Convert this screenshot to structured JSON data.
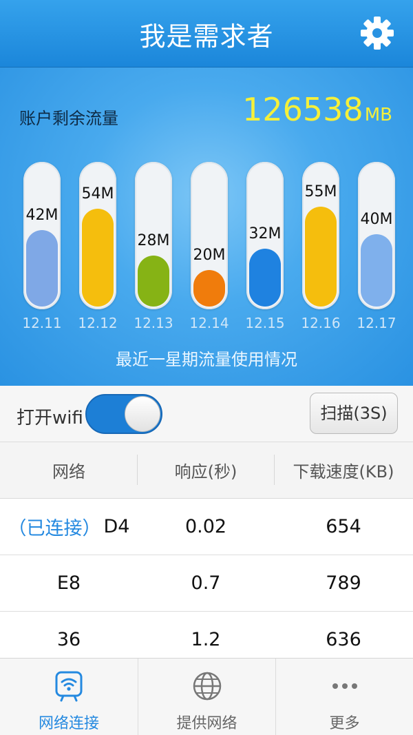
{
  "header": {
    "title": "我是需求者",
    "settings_icon": "gear-icon"
  },
  "traffic": {
    "label": "账户剩余流量",
    "remaining_value": "126538",
    "remaining_unit": "MB",
    "caption": "最近一星期流量使用情况"
  },
  "chart_data": {
    "type": "bar",
    "categories": [
      "12.11",
      "12.12",
      "12.13",
      "12.14",
      "12.15",
      "12.16",
      "12.17"
    ],
    "values": [
      42,
      54,
      28,
      20,
      32,
      55,
      40
    ],
    "value_labels": [
      "42M",
      "54M",
      "28M",
      "20M",
      "32M",
      "55M",
      "40M"
    ],
    "colors": [
      "#7fa8e6",
      "#f5be0d",
      "#86b315",
      "#f07c0c",
      "#1f82e0",
      "#f5be0d",
      "#7fb0ec"
    ],
    "ylim": [
      0,
      60
    ],
    "title": "最近一星期流量使用情况"
  },
  "wifi": {
    "label": "打开wifi",
    "enabled": true,
    "scan_label": "扫描(3S)"
  },
  "table": {
    "headers": [
      "网络",
      "响应(秒)",
      "下载速度(KB)"
    ],
    "connected_tag": "（已连接）",
    "rows": [
      {
        "network": "D4",
        "response": "0.02",
        "speed": "654",
        "connected": true
      },
      {
        "network": "E8",
        "response": "0.7",
        "speed": "789",
        "connected": false
      },
      {
        "network": "36",
        "response": "1.2",
        "speed": "636",
        "connected": false
      }
    ]
  },
  "tabs": [
    {
      "label": "网络连接",
      "icon": "wifi-router-icon",
      "active": true
    },
    {
      "label": "提供网络",
      "icon": "globe-icon",
      "active": false
    },
    {
      "label": "更多",
      "icon": "more-dots-icon",
      "active": false
    }
  ],
  "colors": {
    "accent": "#2489e0",
    "highlight": "#f5f03a"
  }
}
